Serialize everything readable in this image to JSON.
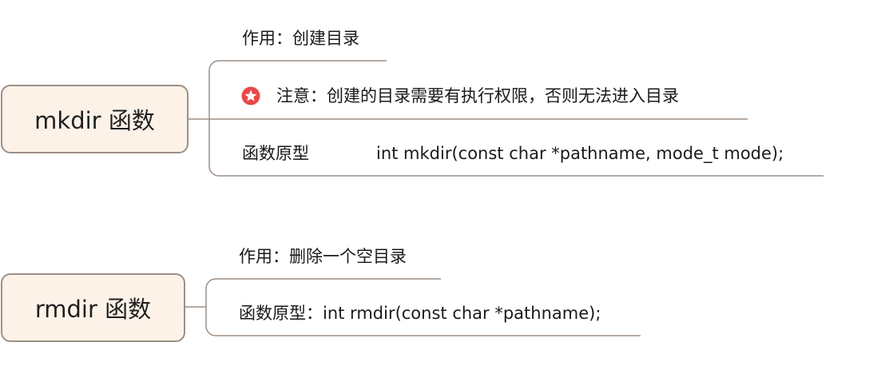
{
  "nodes": {
    "mkdir": {
      "title": "mkdir 函数",
      "purpose": "作用：创建目录",
      "note": "注意：创建的目录需要有执行权限，否则无法进入目录",
      "prototype_label": "函数原型",
      "prototype_code": "int mkdir(const char *pathname, mode_t mode);"
    },
    "rmdir": {
      "title": "rmdir 函数",
      "purpose": "作用：删除一个空目录",
      "prototype": "函数原型：int rmdir(const char *pathname);"
    }
  },
  "icons": {
    "note_marker": "star-icon"
  },
  "colors": {
    "node_fill": "#fdf2e8",
    "node_border": "#9c8f86",
    "connector": "#9c8f86",
    "star_badge": "#e8494a"
  }
}
